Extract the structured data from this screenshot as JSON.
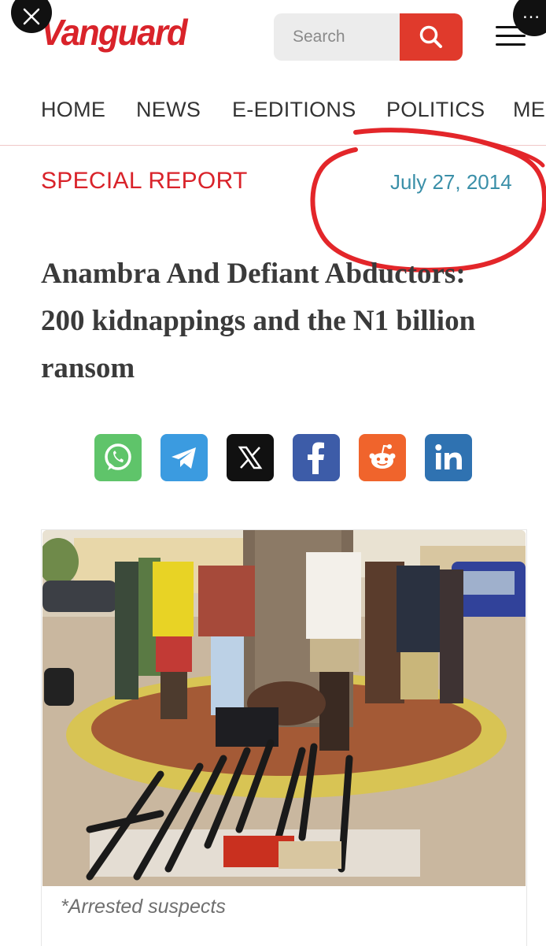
{
  "header": {
    "logo": "Vanguard",
    "search_placeholder": "Search"
  },
  "nav": {
    "items": [
      "HOME",
      "NEWS",
      "E-EDITIONS",
      "POLITICS",
      "ME"
    ]
  },
  "article": {
    "category": "SPECIAL REPORT",
    "date": "July 27, 2014",
    "headline": "Anambra And Defiant Abductors: 200 kidnappings and the N1 billion ransom",
    "image_caption": "*Arrested suspects"
  },
  "share": {
    "buttons": [
      {
        "name": "whatsapp",
        "color": "#5fc46a"
      },
      {
        "name": "telegram",
        "color": "#3b9be0"
      },
      {
        "name": "x",
        "color": "#111111"
      },
      {
        "name": "facebook",
        "color": "#3d5ca8"
      },
      {
        "name": "reddit",
        "color": "#f0642c"
      },
      {
        "name": "linkedin",
        "color": "#2f72b1"
      }
    ]
  },
  "colors": {
    "brand": "#d9232a",
    "date": "#3a8fa8",
    "annotation": "#e3262a"
  }
}
